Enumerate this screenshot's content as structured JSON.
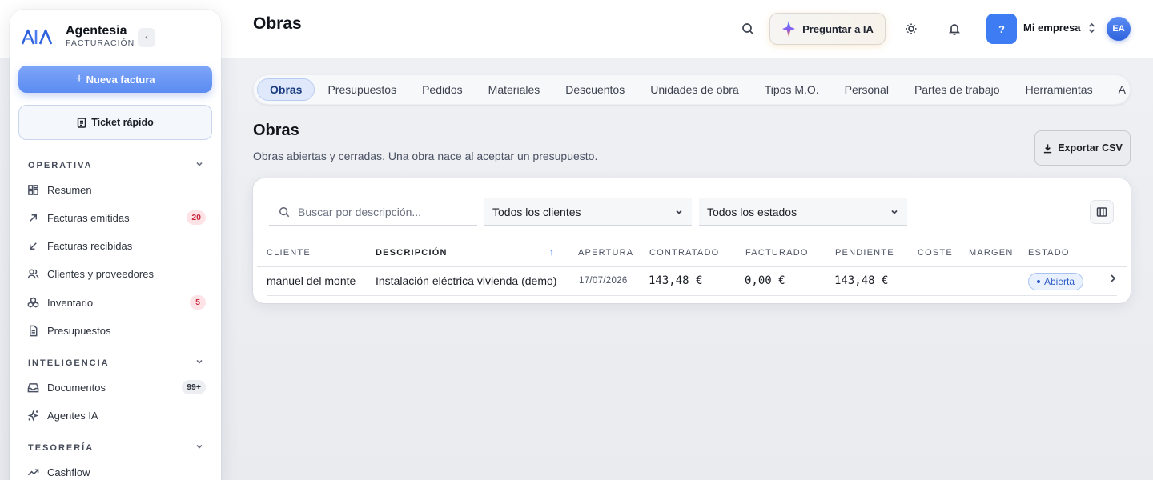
{
  "brand": {
    "name": "Agentesia",
    "subtitle": "FACTURACIÓN",
    "collapse_glyph": "‹"
  },
  "sidebar": {
    "primary_button": "Nueva factura",
    "secondary_button": "Ticket rápido",
    "sections": [
      {
        "title": "OPERATIVA",
        "items": [
          {
            "label": "Resumen",
            "icon": "grid-icon"
          },
          {
            "label": "Facturas emitidas",
            "icon": "arrow-up-right-icon",
            "badge": "20",
            "badge_style": "red"
          },
          {
            "label": "Facturas recibidas",
            "icon": "arrow-down-left-icon"
          },
          {
            "label": "Clientes y proveedores",
            "icon": "users-icon"
          },
          {
            "label": "Inventario",
            "icon": "boxes-icon",
            "badge": "5",
            "badge_style": "red"
          },
          {
            "label": "Presupuestos",
            "icon": "document-icon"
          }
        ]
      },
      {
        "title": "INTELIGENCIA",
        "items": [
          {
            "label": "Documentos",
            "icon": "inbox-icon",
            "badge": "99+",
            "badge_style": "gray"
          },
          {
            "label": "Agentes IA",
            "icon": "sparkles-icon"
          }
        ]
      },
      {
        "title": "TESORERÍA",
        "items": [
          {
            "label": "Cashflow",
            "icon": "trend-icon"
          }
        ]
      }
    ]
  },
  "header": {
    "title": "Obras",
    "ask_ai": "Preguntar a IA",
    "help": "?",
    "company": "Mi empresa",
    "avatar": "EA"
  },
  "tabs": [
    {
      "label": "Obras",
      "active": true
    },
    {
      "label": "Presupuestos"
    },
    {
      "label": "Pedidos"
    },
    {
      "label": "Materiales"
    },
    {
      "label": "Descuentos"
    },
    {
      "label": "Unidades de obra"
    },
    {
      "label": "Tipos M.O."
    },
    {
      "label": "Personal"
    },
    {
      "label": "Partes de trabajo"
    },
    {
      "label": "Herramientas"
    },
    {
      "label": "A"
    }
  ],
  "main": {
    "title": "Obras",
    "description": "Obras abiertas y cerradas. Una obra nace al aceptar un presupuesto.",
    "export_label": "Exportar CSV"
  },
  "filters": {
    "search_placeholder": "Buscar por descripción...",
    "client_select": "Todos los clientes",
    "state_select": "Todos los estados"
  },
  "table": {
    "columns": [
      "CLIENTE",
      "DESCRIPCIÓN",
      "APERTURA",
      "CONTRATADO",
      "FACTURADO",
      "PENDIENTE",
      "COSTE",
      "MARGEN",
      "ESTADO"
    ],
    "sort_glyph": "↑",
    "rows": [
      {
        "cliente": "manuel del monte",
        "descripcion": "Instalación eléctrica vivienda (demo)",
        "apertura": "17/07/2026",
        "contratado": "143,48 €",
        "facturado": "0,00 €",
        "pendiente": "143,48 €",
        "coste": "—",
        "margen": "—",
        "estado": "Abierta"
      }
    ]
  },
  "colors": {
    "accent": "#3e7cf4",
    "badge_red": "#c9283f",
    "status_blue": "#2d5cc8"
  }
}
